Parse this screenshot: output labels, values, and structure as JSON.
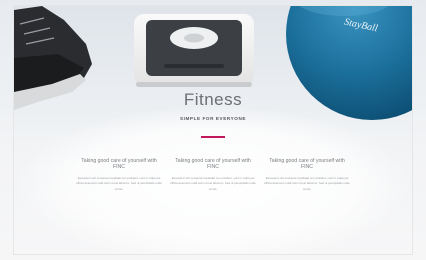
{
  "hero": {
    "title": "Fitness",
    "subtitle": "SIMPLE FOR EVERYONE",
    "ball_brand": "StayBall",
    "accent_color": "#c2185b"
  },
  "columns": [
    {
      "heading": "Taking good care of yourself with FINC",
      "text": "Excepteur sint occaecat cupidatat non proident, sunt in culpa qui officia deserunt mollit anim id est laborum. Sed ut perspiciatis unde omnis."
    },
    {
      "heading": "Taking good care of yourself with FINC",
      "text": "Excepteur sint occaecat cupidatat non proident, sunt in culpa qui officia deserunt mollit anim id est laborum. Sed ut perspiciatis unde omnis."
    },
    {
      "heading": "Taking good care of yourself with FINC",
      "text": "Excepteur sint occaecat cupidatat non proident, sunt in culpa qui officia deserunt mollit anim id est laborum. Sed ut perspiciatis unde omnis."
    }
  ]
}
